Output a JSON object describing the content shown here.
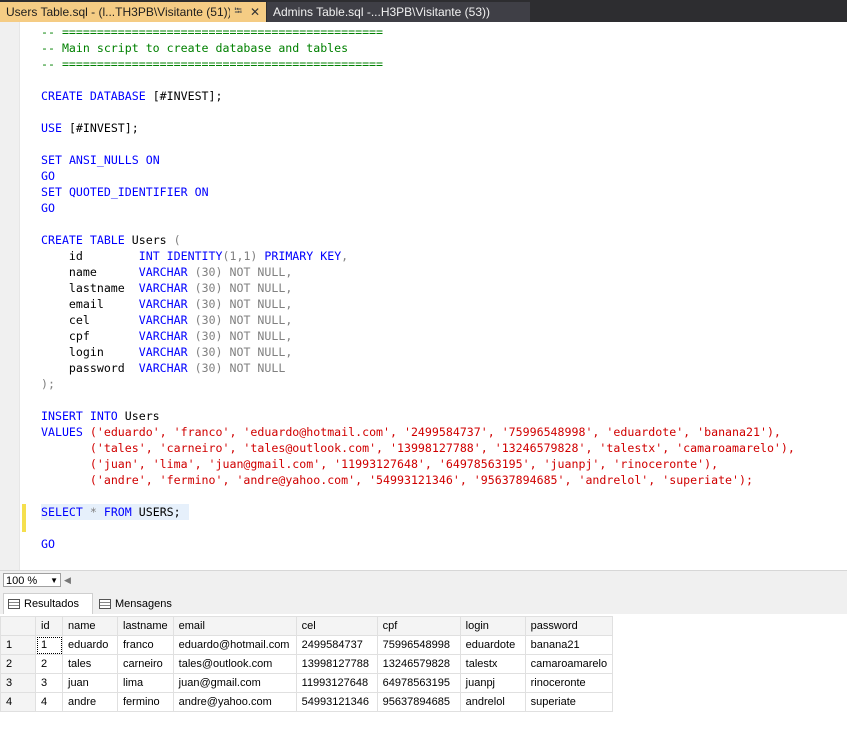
{
  "tabs": [
    {
      "label": "Users Table.sql - (l...TH3PB\\Visitante (51))*",
      "active": true
    },
    {
      "label": "Admins Table.sql -...H3PB\\Visitante (53))",
      "active": false
    }
  ],
  "icons": {
    "pin": "pin-icon",
    "close": "close-icon",
    "grid": "grid-icon",
    "messages": "messages-icon"
  },
  "colors": {
    "active_tab": "#f5cc84",
    "keyword": "#0000ff",
    "string": "#d00000",
    "comment": "#008000",
    "change_bar": "#f5df4d"
  },
  "code": {
    "l1": "-- ==============================================",
    "l2": "-- Main script to create database and tables",
    "l3": "-- ==============================================",
    "create_db": "CREATE DATABASE",
    "db_name": "[#INVEST];",
    "use": "USE",
    "use_db": "[#INVEST];",
    "set": "SET",
    "ansi": "ANSI_NULLS",
    "on": "ON",
    "go": "GO",
    "quoted": "QUOTED_IDENTIFIER",
    "create_table": "CREATE TABLE",
    "users": "Users",
    "paren_open": "(",
    "id_col": "id",
    "int_identity": "INT IDENTITY",
    "identity_args": "(1,1)",
    "primary_key": "PRIMARY KEY",
    "comma": ",",
    "name_col": "name",
    "lastname_col": "lastname",
    "email_col": "email",
    "cel_col": "cel",
    "cpf_col": "cpf",
    "login_col": "login",
    "password_col": "password",
    "varchar": "VARCHAR",
    "len": "(30)",
    "not_null": "NOT NULL",
    "close_paren": ");",
    "insert": "INSERT INTO",
    "values_kw": "VALUES",
    "v1": "('eduardo', 'franco', 'eduardo@hotmail.com', '2499584737', '75996548998', 'eduardote', 'banana21'),",
    "v2": "('tales', 'carneiro', 'tales@outlook.com', '13998127788', '13246579828', 'talestx', 'camaroamarelo'),",
    "v3": "('juan', 'lima', 'juan@gmail.com', '11993127648', '64978563195', 'juanpj', 'rinoceronte'),",
    "v4": "('andre', 'fermino', 'andre@yahoo.com', '54993121346', '95637894685', 'andrelol', 'superiate');",
    "select": "SELECT",
    "star": "*",
    "from": "FROM",
    "users_upper": "USERS;"
  },
  "zoom": "100 %",
  "results_tabs": {
    "results": "Resultados",
    "messages": "Mensagens"
  },
  "grid": {
    "columns": [
      "id",
      "name",
      "lastname",
      "email",
      "cel",
      "cpf",
      "login",
      "password"
    ],
    "rows": [
      {
        "n": "1",
        "cells": [
          "1",
          "eduardo",
          "franco",
          "eduardo@hotmail.com",
          "2499584737",
          "75996548998",
          "eduardote",
          "banana21"
        ]
      },
      {
        "n": "2",
        "cells": [
          "2",
          "tales",
          "carneiro",
          "tales@outlook.com",
          "13998127788",
          "13246579828",
          "talestx",
          "camaroamarelo"
        ]
      },
      {
        "n": "3",
        "cells": [
          "3",
          "juan",
          "lima",
          "juan@gmail.com",
          "11993127648",
          "64978563195",
          "juanpj",
          "rinoceronte"
        ]
      },
      {
        "n": "4",
        "cells": [
          "4",
          "andre",
          "fermino",
          "andre@yahoo.com",
          "54993121346",
          "95637894685",
          "andrelol",
          "superiate"
        ]
      }
    ]
  }
}
